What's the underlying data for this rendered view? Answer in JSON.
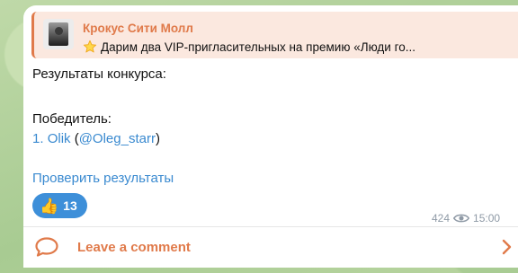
{
  "reply": {
    "channel_name": "Крокус Сити Молл",
    "preview_text": "Дарим два VIP-пригласительных на премию «Люди го..."
  },
  "message": {
    "line1": "Результаты конкурса:",
    "winner_label": "Победитель:",
    "winner_number": "1.",
    "winner_name": "Olik",
    "winner_handle": "@Oleg_starr",
    "check_link": "Проверить результаты"
  },
  "reaction": {
    "emoji": "👍",
    "count": "13"
  },
  "meta": {
    "views": "424",
    "time": "15:00"
  },
  "comment": {
    "label": "Leave a comment"
  },
  "icons": {
    "reply_emoji": "star-icon",
    "views": "eye-icon",
    "comment": "speech-bubble-icon",
    "open": "chevron-right-icon"
  },
  "colors": {
    "accent": "#e07a4a",
    "link": "#3a8ad0",
    "reaction_bg": "#3d8fd9",
    "meta": "#8f9aa6"
  }
}
